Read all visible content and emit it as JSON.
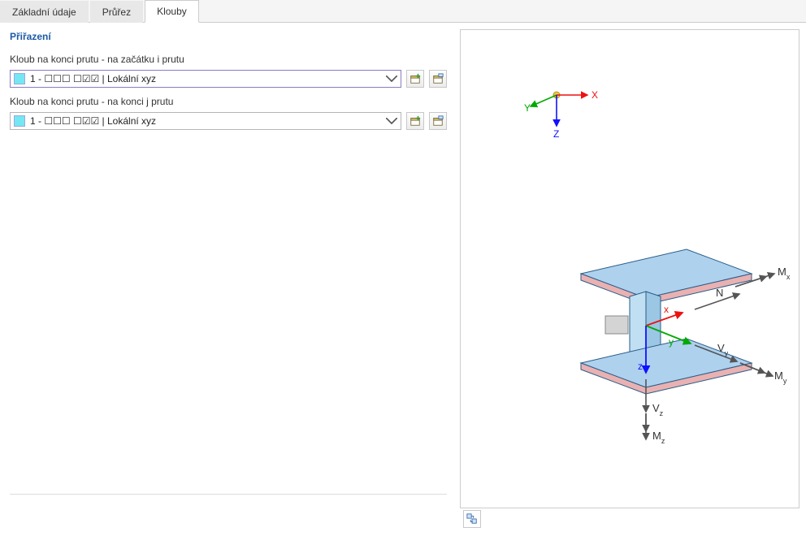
{
  "tabs": [
    {
      "label": "Základní údaje",
      "active": false
    },
    {
      "label": "Průřez",
      "active": false
    },
    {
      "label": "Klouby",
      "active": true
    }
  ],
  "section_title": "Přiřazení",
  "hinge_start": {
    "label": "Kloub na konci prutu - na začátku i prutu",
    "value": "1 - ☐☐☐ ☐☑☑ | Lokální xyz"
  },
  "hinge_end": {
    "label": "Kloub na konci prutu - na konci j prutu",
    "value": "1 - ☐☐☐ ☐☑☑ | Lokální xyz"
  },
  "axes": {
    "x": "X",
    "y": "Y",
    "z": "Z"
  },
  "forces": {
    "N": "N",
    "Vy": "V",
    "Vz": "V",
    "Mx": "M",
    "My": "M",
    "Mz": "M",
    "sub_y": "y",
    "sub_z": "z",
    "sub_x": "x",
    "local_x": "x",
    "local_y": "y",
    "local_z": "z"
  }
}
